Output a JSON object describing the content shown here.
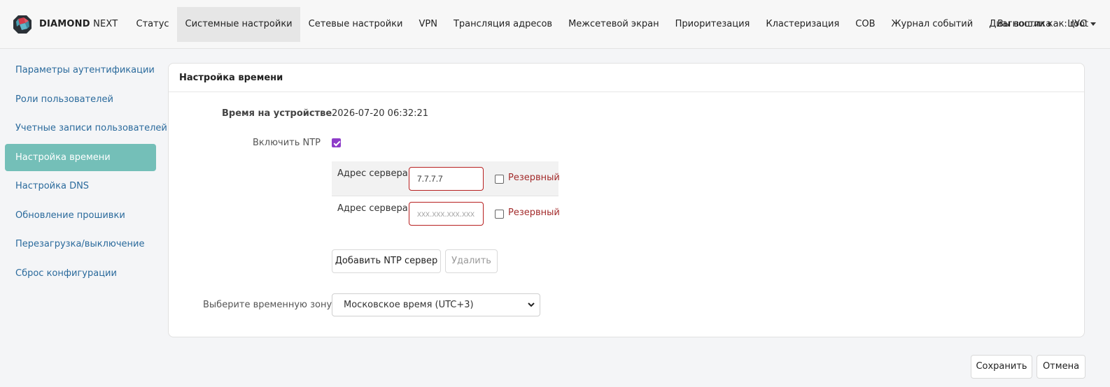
{
  "brand": {
    "bold": "DIAMOND",
    "light": "NEXT"
  },
  "nav": {
    "items": [
      {
        "label": "Статус"
      },
      {
        "label": "Системные настройки"
      },
      {
        "label": "Сетевые настройки"
      },
      {
        "label": "VPN"
      },
      {
        "label": "Трансляция адресов"
      },
      {
        "label": "Межсетевой экран"
      },
      {
        "label": "Приоритезация"
      },
      {
        "label": "Кластеризация"
      },
      {
        "label": "СОВ"
      },
      {
        "label": "Журнал событий"
      },
      {
        "label": "Диагностика"
      },
      {
        "label": "ЦУС"
      }
    ],
    "active_index": 1,
    "user_label": "Вы вошли как: root"
  },
  "sidebar": {
    "items": [
      {
        "label": "Параметры аутентификации"
      },
      {
        "label": "Роли пользователей"
      },
      {
        "label": "Учетные записи пользователей"
      },
      {
        "label": "Настройка времени"
      },
      {
        "label": "Настройка DNS"
      },
      {
        "label": "Обновление прошивки"
      },
      {
        "label": "Перезагрузка/выключение"
      },
      {
        "label": "Сброс конфигурации"
      }
    ],
    "active_index": 3
  },
  "panel": {
    "title": "Настройка времени",
    "device_time_label": "Время на устройстве",
    "device_time_value": "2026-07-20 06:32:21",
    "ntp_label": "Включить NTP",
    "ntp_enabled": true,
    "servers": [
      {
        "label": "Адрес сервера",
        "value": "7.7.7.7",
        "placeholder": "",
        "reserve_label": "Резервный",
        "reserve_checked": false
      },
      {
        "label": "Адрес сервера",
        "value": "",
        "placeholder": "xxx.xxx.xxx.xxx",
        "reserve_label": "Резервный",
        "reserve_checked": false
      }
    ],
    "add_button": "Добавить NTP сервер",
    "delete_button": "Удалить",
    "timezone_label": "Выберите временную зону",
    "timezone_value": "Московское время (UTC+3)"
  },
  "footer": {
    "save_button": "Сохранить",
    "cancel_button": "Отмена"
  },
  "colors": {
    "accent": "#74bfb8",
    "link": "#2a6a9c",
    "checkbox": "#8e3cc9",
    "error": "#b72020"
  }
}
